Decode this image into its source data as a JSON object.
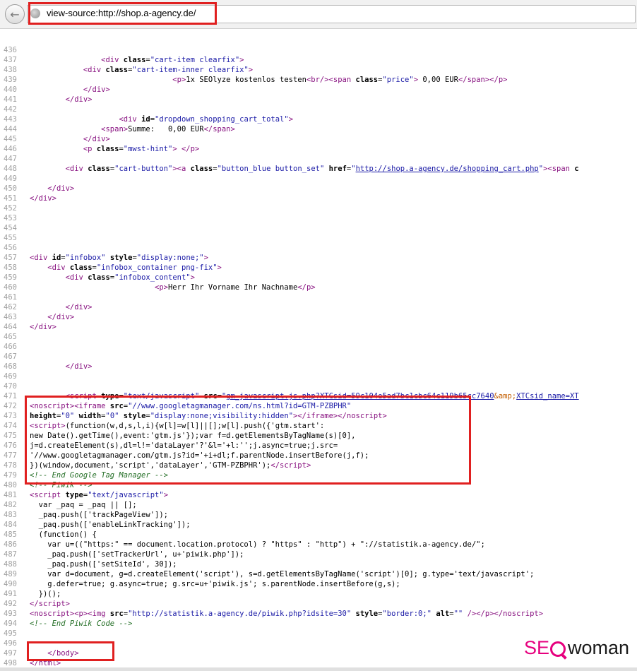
{
  "browser": {
    "url": "view-source:http://shop.a-agency.de/",
    "back_icon": "←"
  },
  "brand": {
    "se": "SE",
    "woman": "woman",
    "accent_color": "#e6007e"
  },
  "lines": [
    {
      "n": "436",
      "html": ""
    },
    {
      "n": "437",
      "html": "                <span class=\"tag\">&lt;div</span> <span class=\"an\">class</span>=<span class=\"av\">\"cart-item clearfix\"</span><span class=\"tag\">&gt;</span>"
    },
    {
      "n": "438",
      "html": "            <span class=\"tag\">&lt;div</span> <span class=\"an\">class</span>=<span class=\"av\">\"cart-item-inner clearfix\"</span><span class=\"tag\">&gt;</span>"
    },
    {
      "n": "439",
      "html": "                                <span class=\"tag\">&lt;p&gt;</span>1x SEOlyze kostenlos testen<span class=\"tag\">&lt;br/&gt;</span><span class=\"tag\">&lt;span</span> <span class=\"an\">class</span>=<span class=\"av\">\"price\"</span><span class=\"tag\">&gt;</span> 0,00 EUR<span class=\"tag\">&lt;/span&gt;&lt;/p&gt;</span>"
    },
    {
      "n": "440",
      "html": "            <span class=\"tag\">&lt;/div&gt;</span>"
    },
    {
      "n": "441",
      "html": "        <span class=\"tag\">&lt;/div&gt;</span>"
    },
    {
      "n": "442",
      "html": ""
    },
    {
      "n": "443",
      "html": "                    <span class=\"tag\">&lt;div</span> <span class=\"an\">id</span>=<span class=\"av\">\"dropdown_shopping_cart_total\"</span><span class=\"tag\">&gt;</span>"
    },
    {
      "n": "444",
      "html": "                <span class=\"tag\">&lt;span&gt;</span>Summe:   0,00 EUR<span class=\"tag\">&lt;/span&gt;</span>"
    },
    {
      "n": "445",
      "html": "            <span class=\"tag\">&lt;/div&gt;</span>"
    },
    {
      "n": "446",
      "html": "            <span class=\"tag\">&lt;p</span> <span class=\"an\">class</span>=<span class=\"av\">\"mwst-hint\"</span><span class=\"tag\">&gt;</span> <span class=\"tag\">&lt;/p&gt;</span>"
    },
    {
      "n": "447",
      "html": ""
    },
    {
      "n": "448",
      "html": "        <span class=\"tag\">&lt;div</span> <span class=\"an\">class</span>=<span class=\"av\">\"cart-button\"</span><span class=\"tag\">&gt;&lt;a</span> <span class=\"an\">class</span>=<span class=\"av\">\"button_blue button_set\"</span> <span class=\"an\">href</span>=<span class=\"av\">\"</span><span class=\"lk\">http://shop.a-agency.de/shopping_cart.php</span><span class=\"av\">\"</span><span class=\"tag\">&gt;&lt;span</span> <span class=\"an\">c</span>"
    },
    {
      "n": "449",
      "html": ""
    },
    {
      "n": "450",
      "html": "    <span class=\"tag\">&lt;/div&gt;</span>"
    },
    {
      "n": "451",
      "html": "<span class=\"tag\">&lt;/div&gt;</span>"
    },
    {
      "n": "452",
      "html": ""
    },
    {
      "n": "453",
      "html": ""
    },
    {
      "n": "454",
      "html": ""
    },
    {
      "n": "455",
      "html": ""
    },
    {
      "n": "456",
      "html": ""
    },
    {
      "n": "457",
      "html": "<span class=\"tag\">&lt;div</span> <span class=\"an\">id</span>=<span class=\"av\">\"infobox\"</span> <span class=\"an\">style</span>=<span class=\"av\">\"display:none;\"</span><span class=\"tag\">&gt;</span>"
    },
    {
      "n": "458",
      "html": "    <span class=\"tag\">&lt;div</span> <span class=\"an\">class</span>=<span class=\"av\">\"infobox_container png-fix\"</span><span class=\"tag\">&gt;</span>"
    },
    {
      "n": "459",
      "html": "        <span class=\"tag\">&lt;div</span> <span class=\"an\">class</span>=<span class=\"av\">\"infobox_content\"</span><span class=\"tag\">&gt;</span>"
    },
    {
      "n": "460",
      "html": "                            <span class=\"tag\">&lt;p&gt;</span>Herr Ihr Vorname Ihr Nachname<span class=\"tag\">&lt;/p&gt;</span>"
    },
    {
      "n": "461",
      "html": ""
    },
    {
      "n": "462",
      "html": "        <span class=\"tag\">&lt;/div&gt;</span>"
    },
    {
      "n": "463",
      "html": "    <span class=\"tag\">&lt;/div&gt;</span>"
    },
    {
      "n": "464",
      "html": "<span class=\"tag\">&lt;/div&gt;</span>"
    },
    {
      "n": "465",
      "html": ""
    },
    {
      "n": "466",
      "html": ""
    },
    {
      "n": "467",
      "html": ""
    },
    {
      "n": "468",
      "html": "        <span class=\"tag\">&lt;/div&gt;</span>"
    },
    {
      "n": "469",
      "html": ""
    },
    {
      "n": "470",
      "html": ""
    },
    {
      "n": "471",
      "html": "        <span class=\"tag\">&lt;script</span> <span class=\"an\">type</span>=<span class=\"av\">\"text/javascript\"</span> <span class=\"an\">src</span>=<span class=\"av\">\"</span><span class=\"lk\">gm_javascript.js.php?XTCsid=59c104e5ad7bc1cbc64c119b65cc7640</span><span class=\"ent\">&amp;amp;</span><span class=\"lk\">XTCsid_name=XT</span>"
    },
    {
      "n": "472",
      "html": "<span class=\"tag\">&lt;noscript&gt;&lt;iframe</span> <span class=\"an\">src</span>=<span class=\"av\">\"//www.googletagmanager.com/ns.html?id=GTM-PZBPHR\"</span>"
    },
    {
      "n": "473",
      "html": "<span class=\"an\">height</span>=<span class=\"av\">\"0\"</span> <span class=\"an\">width</span>=<span class=\"av\">\"0\"</span> <span class=\"an\">style</span>=<span class=\"av\">\"display:none;visibility:hidden\"</span><span class=\"tag\">&gt;&lt;/iframe&gt;&lt;/noscript&gt;</span>"
    },
    {
      "n": "474",
      "html": "<span class=\"tag\">&lt;script&gt;</span>(function(w,d,s,l,i){w[l]=w[l]||[];w[l].push({'gtm.start':"
    },
    {
      "n": "475",
      "html": "new Date().getTime(),event:'gtm.js'});var f=d.getElementsByTagName(s)[0],"
    },
    {
      "n": "476",
      "html": "j=d.createElement(s),dl=l!='dataLayer'?'&amp;l='+l:'';j.async=true;j.src="
    },
    {
      "n": "477",
      "html": "'//www.googletagmanager.com/gtm.js?id='+i+dl;f.parentNode.insertBefore(j,f);"
    },
    {
      "n": "478",
      "html": "})(window,document,'script','dataLayer','GTM-PZBPHR');<span class=\"tag\">&lt;/script&gt;</span>"
    },
    {
      "n": "479",
      "html": "<span class=\"cm\">&lt;!-- End Google Tag Manager --&gt;</span>"
    },
    {
      "n": "480",
      "html": "<span class=\"cm\">&lt;!-- Piwik --&gt;</span>"
    },
    {
      "n": "481",
      "html": "<span class=\"tag\">&lt;script</span> <span class=\"an\">type</span>=<span class=\"av\">\"text/javascript\"</span><span class=\"tag\">&gt;</span>"
    },
    {
      "n": "482",
      "html": "  var _paq = _paq || [];"
    },
    {
      "n": "483",
      "html": "  _paq.push(['trackPageView']);"
    },
    {
      "n": "484",
      "html": "  _paq.push(['enableLinkTracking']);"
    },
    {
      "n": "485",
      "html": "  (function() {"
    },
    {
      "n": "486",
      "html": "    var u=((\"https:\" == document.location.protocol) ? \"https\" : \"http\") + \"://statistik.a-agency.de/\";"
    },
    {
      "n": "487",
      "html": "    _paq.push(['setTrackerUrl', u+'piwik.php']);"
    },
    {
      "n": "488",
      "html": "    _paq.push(['setSiteId', 30]);"
    },
    {
      "n": "489",
      "html": "    var d=document, g=d.createElement('script'), s=d.getElementsByTagName('script')[0]; g.type='text/javascript';"
    },
    {
      "n": "490",
      "html": "    g.defer=true; g.async=true; g.src=u+'piwik.js'; s.parentNode.insertBefore(g,s);"
    },
    {
      "n": "491",
      "html": "  })();"
    },
    {
      "n": "492",
      "html": "<span class=\"tag\">&lt;/script&gt;</span>"
    },
    {
      "n": "493",
      "html": "<span class=\"tag\">&lt;noscript&gt;&lt;p&gt;&lt;img</span> <span class=\"an\">src</span>=<span class=\"av\">\"http://statistik.a-agency.de/piwik.php?idsite=30\"</span> <span class=\"an\">style</span>=<span class=\"av\">\"border:0;\"</span> <span class=\"an\">alt</span>=<span class=\"av\">\"\"</span> <span class=\"tag\">/&gt;&lt;/p&gt;&lt;/noscript&gt;</span>"
    },
    {
      "n": "494",
      "html": "<span class=\"cm\">&lt;!-- End Piwik Code --&gt;</span>"
    },
    {
      "n": "495",
      "html": ""
    },
    {
      "n": "496",
      "html": ""
    },
    {
      "n": "497",
      "html": "    <span class=\"tag\">&lt;/body&gt;</span>"
    },
    {
      "n": "498",
      "html": "<span class=\"tag\">&lt;/html&gt;</span>"
    }
  ]
}
